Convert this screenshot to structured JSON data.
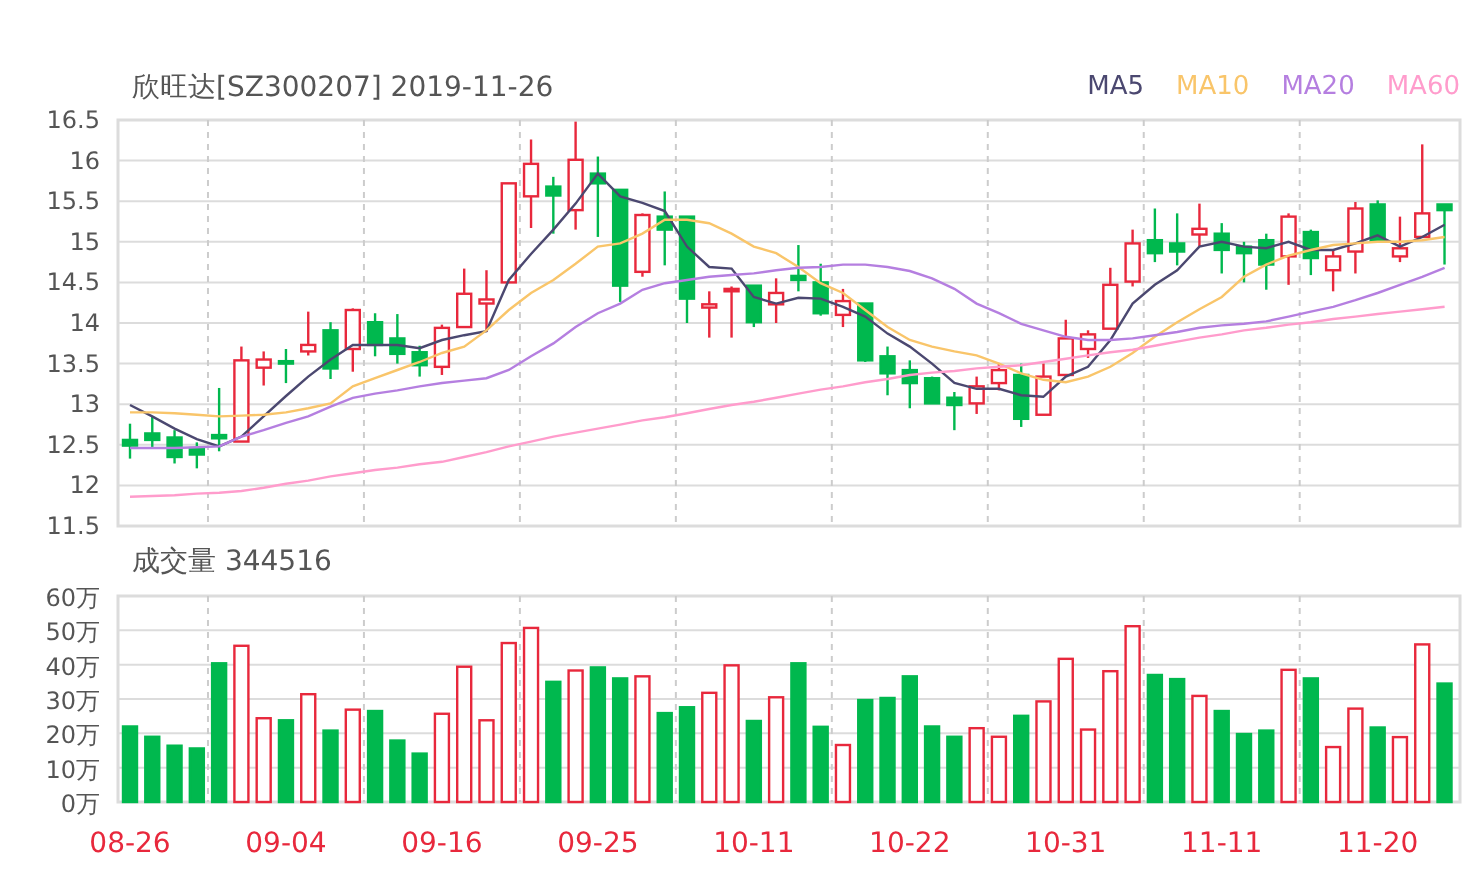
{
  "price_panel": {
    "chart_data": {
      "type": "candlestick",
      "title": "欣旺达[SZ300207] 2019-11-26",
      "grid": true,
      "categories": [
        null,
        null,
        null,
        null,
        null,
        null,
        null,
        null,
        null,
        null,
        null,
        null,
        null,
        null,
        null,
        null,
        null,
        null,
        null,
        null,
        null,
        null,
        null,
        null,
        null,
        null,
        null,
        null,
        null,
        null,
        null,
        null,
        null,
        null,
        null,
        null,
        null,
        null,
        null,
        null,
        null,
        null,
        null,
        null,
        null,
        null,
        null,
        null,
        null,
        null,
        null,
        null,
        null,
        null,
        null,
        null,
        null,
        null,
        null,
        null
      ],
      "ylim": [
        11.5,
        16.5
      ],
      "yticks": [
        11.5,
        12,
        12.5,
        13,
        13.5,
        14,
        14.5,
        15,
        15.5,
        16,
        16.5
      ],
      "ohlc": [
        [
          12.56,
          12.76,
          12.33,
          12.49
        ],
        [
          12.64,
          12.85,
          12.46,
          12.56
        ],
        [
          12.59,
          12.68,
          12.27,
          12.35
        ],
        [
          12.46,
          12.53,
          12.21,
          12.38
        ],
        [
          12.62,
          13.2,
          12.42,
          12.58
        ],
        [
          12.54,
          13.71,
          12.54,
          13.54
        ],
        [
          13.45,
          13.65,
          13.23,
          13.55
        ],
        [
          13.53,
          13.68,
          13.26,
          13.5
        ],
        [
          13.65,
          14.14,
          13.6,
          13.73
        ],
        [
          13.91,
          14.01,
          13.31,
          13.44
        ],
        [
          13.68,
          14.18,
          13.4,
          14.16
        ],
        [
          14.01,
          14.12,
          13.59,
          13.73
        ],
        [
          13.81,
          14.11,
          13.5,
          13.62
        ],
        [
          13.64,
          13.72,
          13.34,
          13.48
        ],
        [
          13.46,
          13.98,
          13.36,
          13.94
        ],
        [
          13.95,
          14.67,
          13.95,
          14.36
        ],
        [
          14.24,
          14.65,
          13.89,
          14.29
        ],
        [
          14.5,
          15.72,
          14.5,
          15.72
        ],
        [
          15.56,
          16.26,
          15.17,
          15.96
        ],
        [
          15.68,
          15.8,
          15.1,
          15.57
        ],
        [
          15.39,
          16.48,
          15.15,
          16.01
        ],
        [
          15.84,
          16.05,
          15.06,
          15.72
        ],
        [
          15.64,
          15.65,
          14.26,
          14.46
        ],
        [
          14.63,
          15.35,
          14.57,
          15.33
        ],
        [
          15.31,
          15.62,
          14.71,
          15.15
        ],
        [
          15.31,
          15.31,
          14.0,
          14.3
        ],
        [
          14.19,
          14.39,
          13.82,
          14.23
        ],
        [
          14.4,
          14.45,
          13.82,
          14.42
        ],
        [
          14.46,
          14.46,
          13.95,
          14.01
        ],
        [
          14.23,
          14.55,
          14.0,
          14.37
        ],
        [
          14.58,
          14.96,
          14.39,
          14.53
        ],
        [
          14.5,
          14.73,
          14.09,
          14.12
        ],
        [
          14.1,
          14.42,
          13.95,
          14.27
        ],
        [
          14.24,
          14.24,
          13.52,
          13.54
        ],
        [
          13.59,
          13.71,
          13.11,
          13.38
        ],
        [
          13.42,
          13.54,
          12.95,
          13.26
        ],
        [
          13.32,
          13.34,
          13.01,
          13.01
        ],
        [
          13.08,
          13.15,
          12.68,
          12.99
        ],
        [
          13.01,
          13.34,
          12.88,
          13.22
        ],
        [
          13.26,
          13.5,
          13.17,
          13.42
        ],
        [
          13.36,
          13.5,
          12.72,
          12.82
        ],
        [
          12.87,
          13.5,
          12.87,
          13.34
        ],
        [
          13.36,
          14.04,
          13.36,
          13.81
        ],
        [
          13.68,
          13.91,
          13.57,
          13.86
        ],
        [
          13.93,
          14.68,
          13.93,
          14.47
        ],
        [
          14.51,
          15.15,
          14.45,
          14.98
        ],
        [
          15.02,
          15.41,
          14.75,
          14.86
        ],
        [
          14.98,
          15.35,
          14.71,
          14.88
        ],
        [
          15.09,
          15.47,
          14.94,
          15.16
        ],
        [
          15.1,
          15.23,
          14.61,
          14.9
        ],
        [
          14.94,
          15.0,
          14.5,
          14.86
        ],
        [
          15.02,
          15.1,
          14.41,
          14.72
        ],
        [
          14.82,
          15.35,
          14.47,
          15.31
        ],
        [
          15.12,
          15.15,
          14.59,
          14.8
        ],
        [
          14.65,
          14.9,
          14.39,
          14.82
        ],
        [
          14.88,
          15.49,
          14.61,
          15.41
        ],
        [
          15.46,
          15.51,
          15.01,
          15.01
        ],
        [
          14.82,
          15.31,
          14.75,
          14.92
        ],
        [
          15.06,
          16.2,
          15.06,
          15.35
        ],
        [
          15.46,
          15.46,
          14.72,
          15.39
        ]
      ]
    },
    "ma_overlay": {
      "chart_data": {
        "type": "line",
        "categories": [
          null,
          null,
          null,
          null,
          null,
          null,
          null,
          null,
          null,
          null,
          null,
          null,
          null,
          null,
          null,
          null,
          null,
          null,
          null,
          null,
          null,
          null,
          null,
          null,
          null,
          null,
          null,
          null,
          null,
          null,
          null,
          null,
          null,
          null,
          null,
          null,
          null,
          null,
          null,
          null,
          null,
          null,
          null,
          null,
          null,
          null,
          null,
          null,
          null,
          null,
          null,
          null,
          null,
          null,
          null,
          null,
          null,
          null,
          null,
          null
        ],
        "ylim": [
          11.5,
          16.5
        ],
        "series": [
          {
            "name": "MA5",
            "color": "#4b4870",
            "values": [
              12.99,
              12.85,
              12.7,
              12.57,
              12.48,
              12.6,
              12.85,
              13.1,
              13.34,
              13.55,
              13.73,
              13.73,
              13.73,
              13.69,
              13.79,
              13.85,
              13.9,
              14.53,
              14.85,
              15.15,
              15.47,
              15.84,
              15.56,
              15.48,
              15.38,
              14.94,
              14.69,
              14.67,
              14.32,
              14.24,
              14.31,
              14.3,
              14.2,
              14.08,
              13.87,
              13.71,
              13.5,
              13.26,
              13.19,
              13.19,
              13.11,
              13.09,
              13.34,
              13.46,
              13.79,
              14.24,
              14.47,
              14.65,
              14.94,
              15.0,
              14.94,
              14.92,
              15.0,
              14.9,
              14.9,
              14.98,
              15.08,
              14.94,
              15.06,
              15.21
            ]
          },
          {
            "name": "MA10",
            "color": "#f9c56a",
            "values": [
              12.9,
              12.9,
              12.89,
              12.87,
              12.85,
              12.86,
              12.87,
              12.9,
              12.95,
              13.01,
              13.22,
              13.32,
              13.42,
              13.52,
              13.63,
              13.71,
              13.91,
              14.16,
              14.37,
              14.53,
              14.73,
              14.94,
              14.98,
              15.1,
              15.27,
              15.27,
              15.23,
              15.1,
              14.94,
              14.86,
              14.69,
              14.49,
              14.37,
              14.16,
              13.95,
              13.79,
              13.71,
              13.65,
              13.6,
              13.5,
              13.38,
              13.3,
              13.27,
              13.34,
              13.46,
              13.63,
              13.83,
              14.01,
              14.17,
              14.32,
              14.57,
              14.72,
              14.83,
              14.9,
              14.96,
              14.98,
              15.0,
              15.0,
              15.02,
              15.06
            ]
          },
          {
            "name": "MA20",
            "color": "#b57fe0",
            "values": [
              12.46,
              12.46,
              12.46,
              12.47,
              12.48,
              12.6,
              12.68,
              12.77,
              12.85,
              12.97,
              13.08,
              13.13,
              13.17,
              13.22,
              13.26,
              13.29,
              13.32,
              13.42,
              13.59,
              13.75,
              13.95,
              14.12,
              14.24,
              14.41,
              14.49,
              14.53,
              14.57,
              14.59,
              14.61,
              14.65,
              14.68,
              14.69,
              14.72,
              14.72,
              14.69,
              14.64,
              14.55,
              14.42,
              14.24,
              14.12,
              13.99,
              13.91,
              13.83,
              13.79,
              13.79,
              13.81,
              13.85,
              13.89,
              13.94,
              13.97,
              13.99,
              14.02,
              14.08,
              14.14,
              14.2,
              14.28,
              14.37,
              14.47,
              14.57,
              14.68
            ]
          },
          {
            "name": "MA60",
            "color": "#ff9ccc",
            "values": [
              11.86,
              11.87,
              11.88,
              11.9,
              11.91,
              11.93,
              11.97,
              12.02,
              12.06,
              12.11,
              12.15,
              12.19,
              12.22,
              12.26,
              12.29,
              12.35,
              12.41,
              12.48,
              12.54,
              12.6,
              12.65,
              12.7,
              12.75,
              12.8,
              12.84,
              12.89,
              12.94,
              12.99,
              13.03,
              13.08,
              13.13,
              13.18,
              13.22,
              13.27,
              13.31,
              13.36,
              13.39,
              13.41,
              13.44,
              13.46,
              13.48,
              13.52,
              13.56,
              13.6,
              13.64,
              13.67,
              13.72,
              13.77,
              13.82,
              13.86,
              13.91,
              13.94,
              13.98,
              14.01,
              14.05,
              14.08,
              14.11,
              14.14,
              14.17,
              14.2
            ]
          }
        ]
      }
    }
  },
  "volume_panel": {
    "chart_data": {
      "type": "bar",
      "title": "成交量 344516",
      "stacked": true,
      "grid": true,
      "categories": [
        "08-26",
        null,
        null,
        null,
        null,
        null,
        null,
        "09-04",
        null,
        null,
        null,
        null,
        null,
        null,
        "09-16",
        null,
        null,
        null,
        null,
        null,
        null,
        "09-25",
        null,
        null,
        null,
        null,
        null,
        null,
        "10-11",
        null,
        null,
        null,
        null,
        null,
        null,
        "10-22",
        null,
        null,
        null,
        null,
        null,
        null,
        "10-31",
        null,
        null,
        null,
        null,
        null,
        null,
        "11-11",
        null,
        null,
        null,
        null,
        null,
        null,
        "11-20",
        null,
        null,
        null
      ],
      "ylim": [
        0,
        60
      ],
      "yticks": [
        {
          "value": 0,
          "label": "0万"
        },
        {
          "value": 10,
          "label": "10万"
        },
        {
          "value": 20,
          "label": "20万"
        },
        {
          "value": 30,
          "label": "30万"
        },
        {
          "value": 40,
          "label": "40万"
        },
        {
          "value": 50,
          "label": "50万"
        },
        {
          "value": 60,
          "label": "60万"
        }
      ],
      "series": [
        {
          "color": "#e8283c",
          "values": [
            null,
            null,
            null,
            null,
            null,
            45.5,
            24.4,
            null,
            31.4,
            null,
            26.9,
            null,
            null,
            null,
            25.7,
            39.4,
            23.8,
            46.3,
            50.7,
            null,
            38.3,
            null,
            null,
            36.6,
            null,
            null,
            31.8,
            39.8,
            null,
            30.5,
            null,
            null,
            16.6,
            null,
            null,
            null,
            null,
            null,
            21.5,
            19,
            null,
            29.3,
            41.7,
            21.1,
            38.1,
            51.2,
            null,
            null,
            30.9,
            null,
            null,
            null,
            38.5,
            null,
            16,
            27.2,
            null,
            18.9,
            45.9,
            null
          ]
        },
        {
          "color": "#00b84e",
          "values": [
            22,
            19,
            16.4,
            15.6,
            40.4,
            null,
            null,
            23.8,
            null,
            20.8,
            null,
            26.5,
            17.9,
            14.1,
            null,
            null,
            null,
            null,
            null,
            35,
            null,
            39.2,
            36,
            null,
            25.9,
            27.6,
            null,
            null,
            23.6,
            null,
            40.4,
            21.9,
            null,
            29.7,
            30.3,
            36.6,
            22,
            19,
            null,
            null,
            25.1,
            null,
            null,
            null,
            null,
            null,
            37,
            35.8,
            null,
            26.5,
            19.8,
            20.8,
            null,
            36,
            null,
            null,
            21.7,
            null,
            null,
            34.5
          ]
        }
      ]
    }
  }
}
